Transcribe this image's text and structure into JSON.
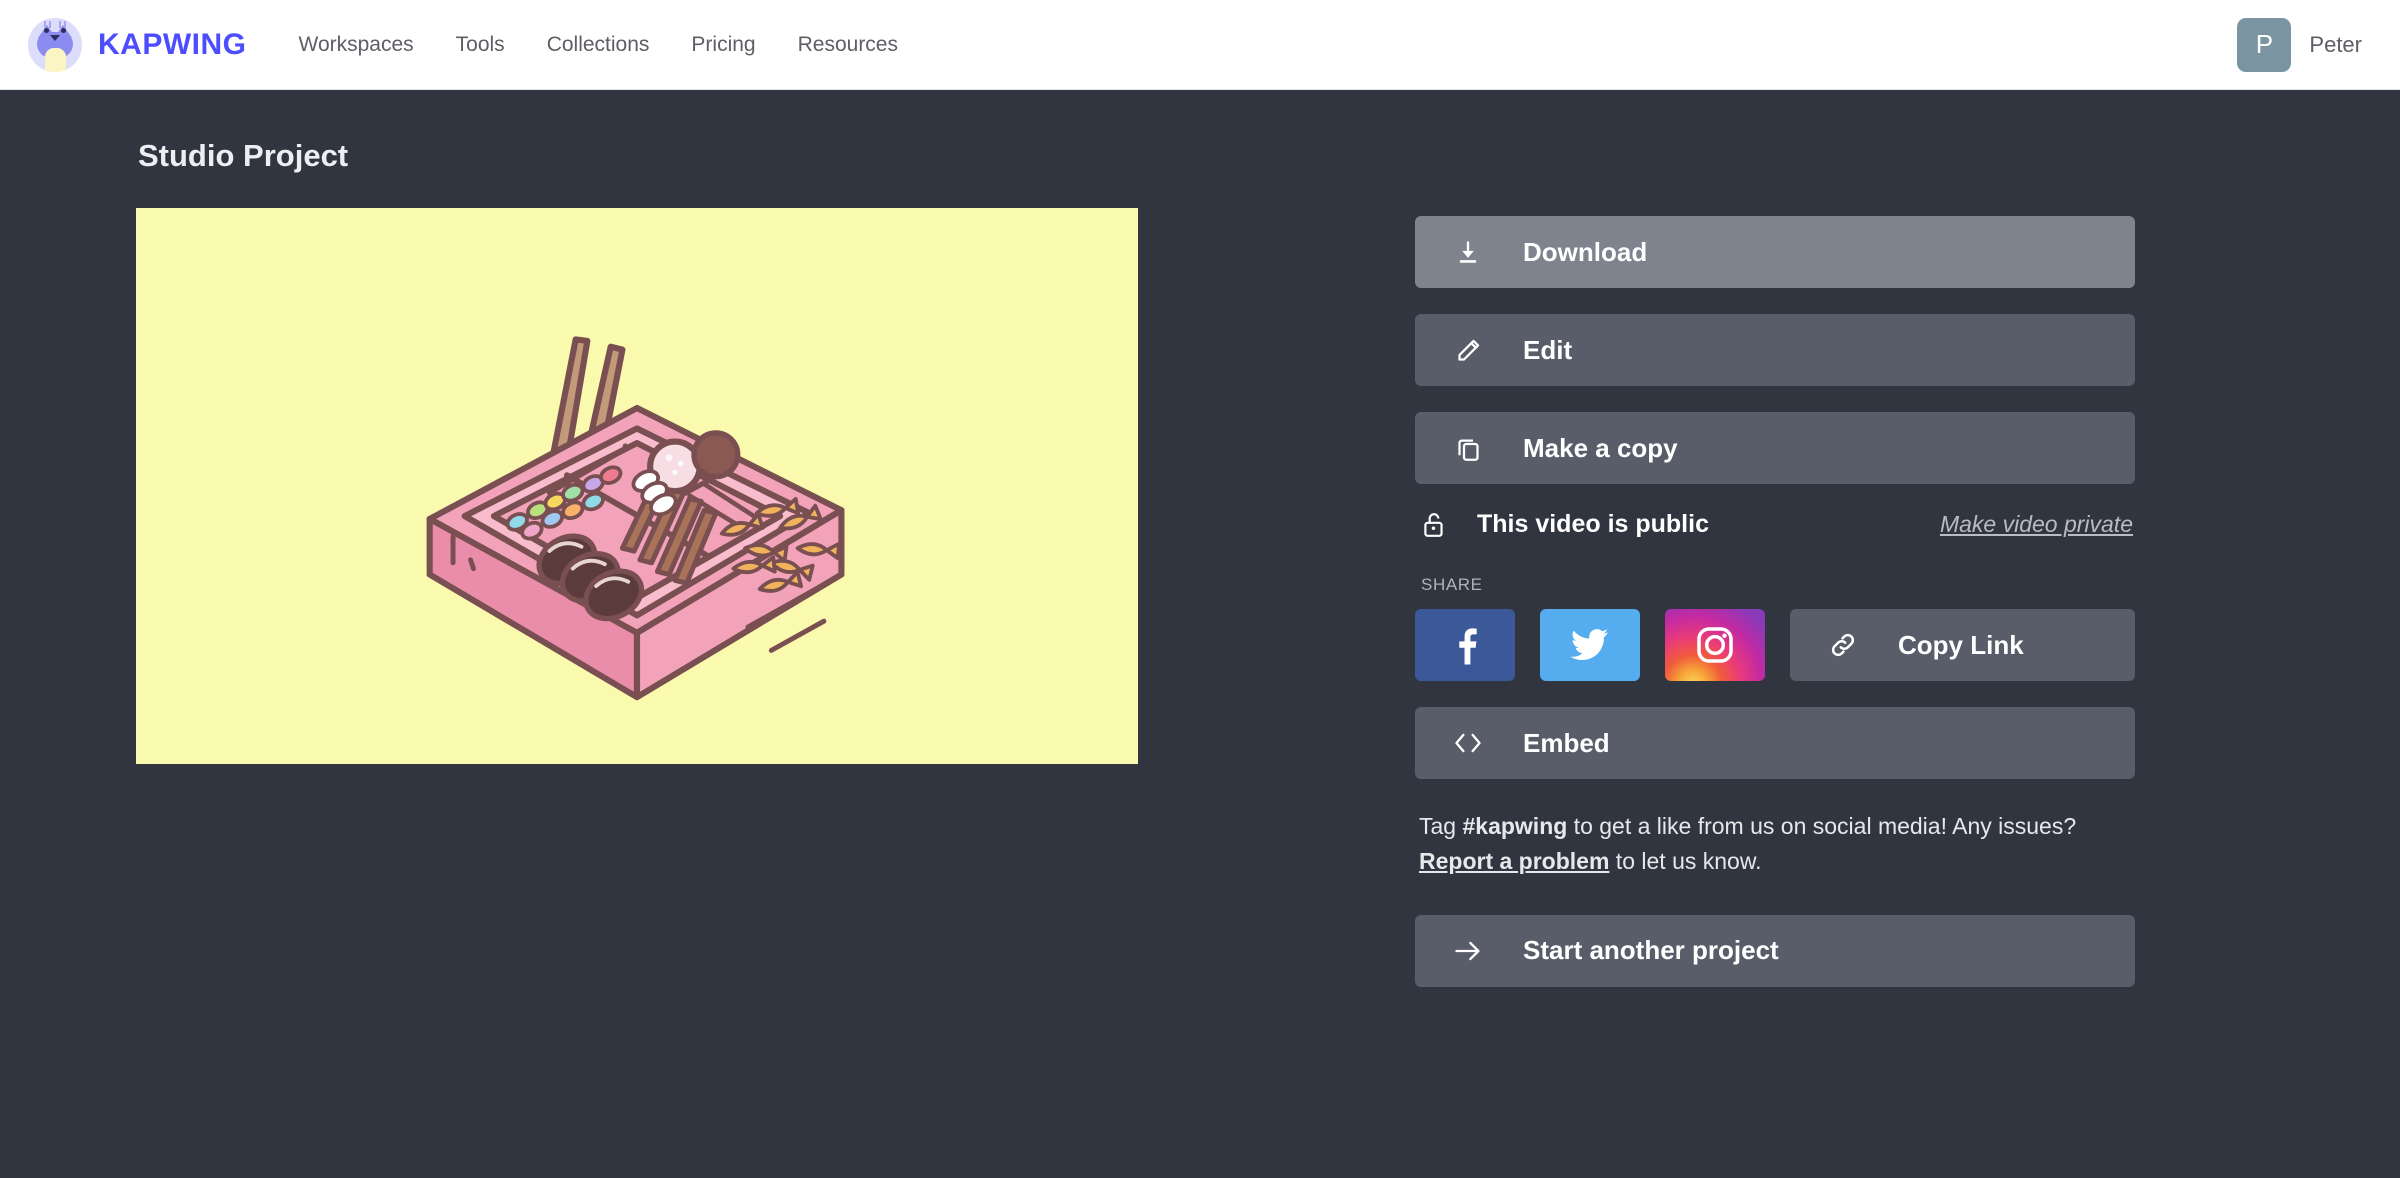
{
  "header": {
    "brand_name": "KAPWING",
    "brand_icon": "cat-avatar-icon",
    "nav": [
      {
        "label": "Workspaces"
      },
      {
        "label": "Tools"
      },
      {
        "label": "Collections"
      },
      {
        "label": "Pricing"
      },
      {
        "label": "Resources"
      }
    ],
    "account": {
      "avatar_initial": "P",
      "name": "Peter"
    }
  },
  "main": {
    "page_title": "Studio Project",
    "video_preview": {
      "background_color": "#fafaae",
      "illustration": "bento-box-illustration"
    }
  },
  "actions": {
    "download_label": "Download",
    "download_icon": "download-icon",
    "edit_label": "Edit",
    "edit_icon": "pencil-icon",
    "copy_label": "Make a copy",
    "copy_icon": "duplicate-icon",
    "embed_label": "Embed",
    "embed_icon": "code-brackets-icon",
    "start_another_label": "Start another project",
    "start_another_icon": "arrow-right-icon"
  },
  "privacy": {
    "icon": "unlocked-padlock-icon",
    "status_text": "This video is public",
    "toggle_link": "Make video private"
  },
  "share": {
    "label": "SHARE",
    "facebook_icon": "facebook-icon",
    "twitter_icon": "twitter-icon",
    "instagram_icon": "instagram-icon",
    "copy_link_label": "Copy Link",
    "copy_link_icon": "chain-link-icon"
  },
  "note": {
    "part1": "Tag ",
    "hashtag": "#kapwing",
    "part2": " to get a like from us on social media! Any issues? ",
    "report_link": "Report a problem",
    "part3": " to let us know."
  },
  "colors": {
    "page_background": "#31353f",
    "button": "#585d69",
    "button_hover": "#7e838d",
    "brand_blue": "#4d4dff",
    "facebook": "#3b5998",
    "twitter": "#55acee",
    "avatar": "#7b94a2"
  }
}
